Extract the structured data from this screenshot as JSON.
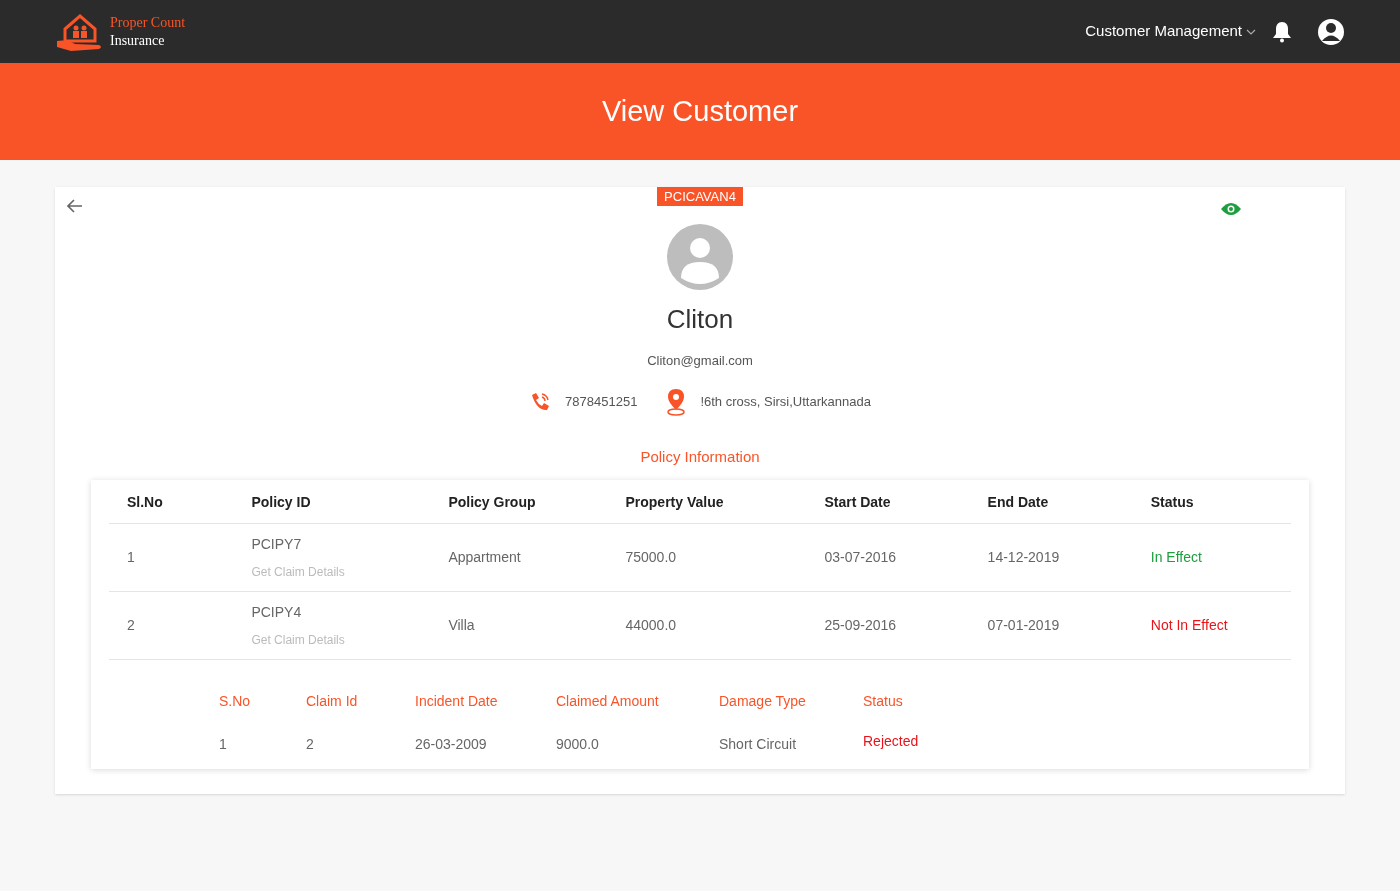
{
  "brand": {
    "line1": "Proper Count",
    "line2": "Insurance"
  },
  "nav": {
    "menu": "Customer Management"
  },
  "banner": {
    "title": "View Customer"
  },
  "customer": {
    "code": "PCICAVAN4",
    "name": "Cliton",
    "email": "Cliton@gmail.com",
    "phone": "7878451251",
    "address": "!6th cross, Sirsi,Uttarkannada"
  },
  "policy_section": {
    "title": "Policy Information"
  },
  "policies": {
    "columns": [
      "Sl.No",
      "Policy ID",
      "Policy Group",
      "Property Value",
      "Start Date",
      "End Date",
      "Status"
    ],
    "rows": [
      {
        "no": "1",
        "policy_id": "PCIPY7",
        "link": "Get Claim Details",
        "group": "Appartment",
        "value": "75000.0",
        "start": "03-07-2016",
        "end": "14-12-2019",
        "status": "In Effect",
        "color": "#1e9e3e"
      },
      {
        "no": "2",
        "policy_id": "PCIPY4",
        "link": "Get Claim Details",
        "group": "Villa",
        "value": "44000.0",
        "start": "25-09-2016",
        "end": "07-01-2019",
        "status": "Not In Effect",
        "color": "#e8131b"
      }
    ]
  },
  "claims": {
    "columns": [
      "S.No",
      "Claim Id",
      "Incident Date",
      "Claimed Amount",
      "Damage Type",
      "Status"
    ],
    "rows": [
      {
        "no": "1",
        "claim_id": "2",
        "incident": "26-03-2009",
        "amount": "9000.0",
        "damage": "Short Circuit",
        "status": "Rejected",
        "color": "#e8131b"
      }
    ]
  }
}
